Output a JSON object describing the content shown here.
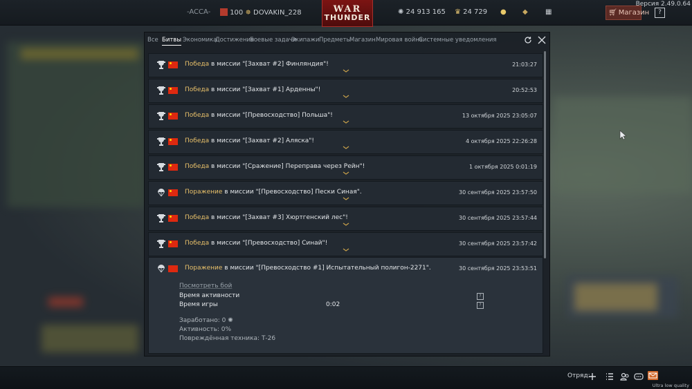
{
  "version": "Версия 2.49.0.64",
  "topbar": {
    "clan_tag": "-ACCA-",
    "rank": "100",
    "nickname": "DOVAKIN_228",
    "logo_line1": "WAR",
    "logo_line2": "THUNDER",
    "silver_lions": "24 913 165",
    "golden_eagles": "24 729",
    "shop_label": "Магазин",
    "help_label": "?"
  },
  "tabs": [
    {
      "label": "Все"
    },
    {
      "label": "Битвы"
    },
    {
      "label": "Экономика"
    },
    {
      "label": "Достижения"
    },
    {
      "label": "Боевые задачи"
    },
    {
      "label": "Экипажи"
    },
    {
      "label": "Предметы"
    },
    {
      "label": "Магазин"
    },
    {
      "label": "Мировая война"
    },
    {
      "label": "Системные уведомления"
    }
  ],
  "rows": [
    {
      "result": "Победа",
      "text": " в миссии \"[Захват #2] Финляндия\"!",
      "time": "21:03:27",
      "icon": "trophy-icon"
    },
    {
      "result": "Победа",
      "text": " в миссии \"[Захват #1] Арденны\"!",
      "time": "20:52:53",
      "icon": "trophy-icon"
    },
    {
      "result": "Победа",
      "text": " в миссии \"[Превосходство] Польша\"!",
      "time": "13 октября 2025 23:05:07",
      "icon": "trophy-icon"
    },
    {
      "result": "Победа",
      "text": " в миссии \"[Захват #2] Аляска\"!",
      "time": "4 октября 2025 22:26:28",
      "icon": "trophy-icon"
    },
    {
      "result": "Победа",
      "text": " в миссии \"[Сражение] Переправа через Рейн\"!",
      "time": "1 октября 2025 0:01:19",
      "icon": "trophy-icon"
    },
    {
      "result": "Поражение",
      "text": " в миссии \"[Превосходство] Пески Синая\".",
      "time": "30 сентября 2025 23:57:50",
      "icon": "parachute-icon"
    },
    {
      "result": "Победа",
      "text": " в миссии \"[Захват #3] Хюртгенский лес\"!",
      "time": "30 сентября 2025 23:57:44",
      "icon": "trophy-icon"
    },
    {
      "result": "Победа",
      "text": " в миссии \"[Превосходство] Синай\"!",
      "time": "30 сентября 2025 23:57:42",
      "icon": "trophy-icon"
    }
  ],
  "expanded": {
    "result": "Поражение",
    "text": " в миссии \"[Превосходство #1] Испытательный полигон-2271\".",
    "time": "30 сентября 2025 23:53:51",
    "view_battle": "Посмотреть бой",
    "activity_time_label": "Время активности",
    "game_time_label": "Время игры",
    "game_time_value": "0:02",
    "earned": "Заработано: 0",
    "activity": "Активность: 0%",
    "damaged": "Повреждённая техника: Т-26"
  },
  "bottombar": {
    "squad_label": "Отряд:",
    "quality": "Ultra low quality"
  }
}
